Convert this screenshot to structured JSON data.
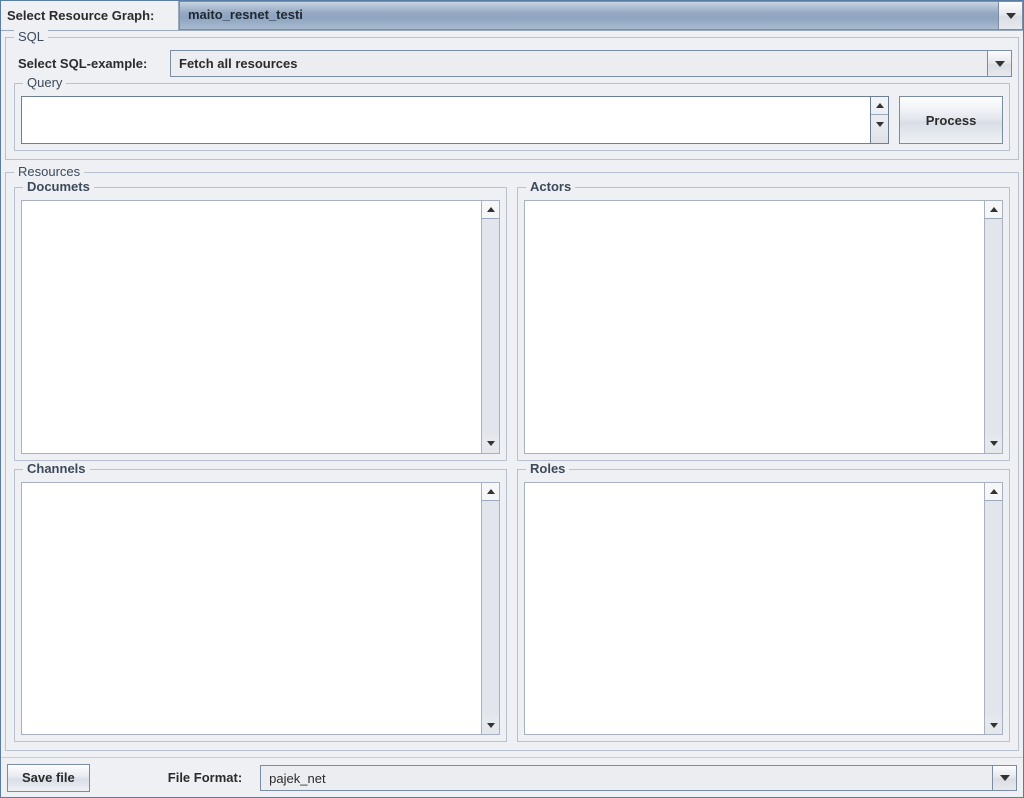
{
  "top": {
    "label": "Select Resource Graph:",
    "value": "maito_resnet_testi"
  },
  "sql": {
    "legend": "SQL",
    "example_label": "Select SQL-example:",
    "example_value": "Fetch all resources",
    "query_legend": "Query",
    "query_value": "",
    "process_label": "Process"
  },
  "resources": {
    "legend": "Resources",
    "panels": [
      {
        "legend": "Documets"
      },
      {
        "legend": "Actors"
      },
      {
        "legend": "Channels"
      },
      {
        "legend": "Roles"
      }
    ]
  },
  "bottom": {
    "save_label": "Save file",
    "format_label": "File Format:",
    "format_value": "pajek_net"
  }
}
